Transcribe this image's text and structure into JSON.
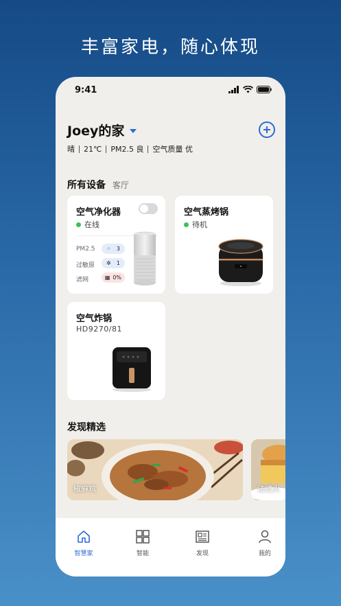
{
  "headline": "丰富家电，随心体现",
  "status_bar": {
    "time": "9:41"
  },
  "home": {
    "title": "Joey的家",
    "weather": [
      "晴",
      "21℃",
      "PM2.5 良",
      "空气质量 优"
    ]
  },
  "devices_section": {
    "title": "所有设备",
    "room": "客厅"
  },
  "devices": {
    "purifier": {
      "name": "空气净化器",
      "status": "在线",
      "metrics": [
        {
          "label": "PM2.5",
          "value": "3"
        },
        {
          "label": "过敏原",
          "value": "1"
        },
        {
          "label": "滤网",
          "value": "0%"
        }
      ]
    },
    "steam_oven": {
      "name": "空气蒸烤锅",
      "status": "待机"
    },
    "air_fryer": {
      "name": "空气炸锅",
      "model": "HD9270/81"
    }
  },
  "discover": {
    "title": "发现精选",
    "items": [
      {
        "caption": "椒麻鸡"
      },
      {
        "caption": "法式火"
      }
    ]
  },
  "tabs": [
    {
      "label": "智慧家",
      "icon": "home-icon",
      "active": true
    },
    {
      "label": "智能",
      "icon": "grid-icon",
      "active": false
    },
    {
      "label": "发现",
      "icon": "news-icon",
      "active": false
    },
    {
      "label": "我的",
      "icon": "person-icon",
      "active": false
    }
  ],
  "colors": {
    "accent": "#2c6ad6",
    "online": "#3cc05a"
  }
}
